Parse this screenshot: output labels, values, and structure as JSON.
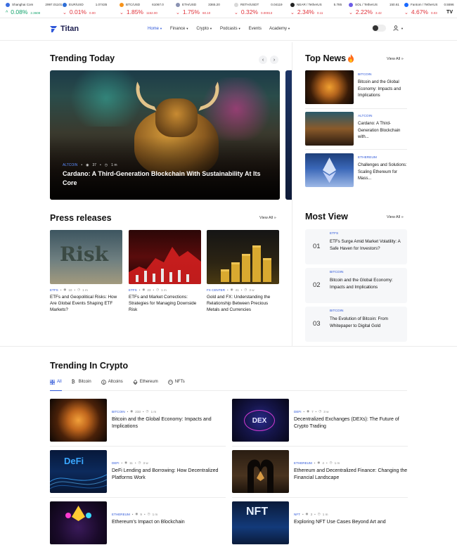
{
  "ticker": [
    {
      "name": "Shanghai Com",
      "price": "2997.01101",
      "change": "0.08%",
      "sub": "2.3608",
      "dir": "up",
      "dot": "#3a6de0"
    },
    {
      "name": "EUR/USD",
      "price": "1.07435",
      "change": "0.01%",
      "sub": "0.00",
      "dir": "down",
      "dot": "#2f6fd6"
    },
    {
      "name": "BTC/USD",
      "price": "61067.0",
      "change": "1.85%",
      "sub": "1152.00",
      "dir": "down",
      "dot": "#f7931a"
    },
    {
      "name": "ETH/USD",
      "price": "3365.20",
      "change": "1.75%",
      "sub": "60.10",
      "dir": "down",
      "dot": "#8a92b2"
    },
    {
      "name": "RETH/USDT",
      "price": "0.04119",
      "change": "0.32%",
      "sub": "0.00013",
      "dir": "down",
      "dot": "#d8d8d8"
    },
    {
      "name": "NEAR / TetherUS",
      "price": "5.785",
      "change": "2.34%",
      "sub": "0.11",
      "dir": "down",
      "dot": "#222222"
    },
    {
      "name": "SOL / TetherUS",
      "price": "150.61",
      "change": "2.22%",
      "sub": "3.42",
      "dir": "down",
      "dot": "#6c5ce7"
    },
    {
      "name": "Fantom / TetherUS",
      "price": "0.5596",
      "change": "4.67%",
      "sub": "0.03",
      "dir": "down",
      "dot": "#1969ff"
    }
  ],
  "tv_logo": "TV",
  "brand": {
    "name": "Titan"
  },
  "menu": [
    {
      "label": "Home",
      "active": true,
      "caret": true
    },
    {
      "label": "Finance",
      "active": false,
      "caret": true
    },
    {
      "label": "Crypto",
      "active": false,
      "caret": true
    },
    {
      "label": "Podcasts",
      "active": false,
      "caret": true
    },
    {
      "label": "Events",
      "active": false,
      "caret": false
    },
    {
      "label": "Academy",
      "active": false,
      "caret": true
    }
  ],
  "trending_today": {
    "title": "Trending Today",
    "prev": "‹",
    "next": "›",
    "hero": {
      "category": "ALTCOIN",
      "views": "37",
      "read_time": "1 m",
      "title": "Cardano: A Third-Generation Blockchain With Sustainability At Its Core"
    }
  },
  "top_news": {
    "title": "Top News",
    "view_all": "View All",
    "items": [
      {
        "category": "BITCOIN",
        "title": "Bitcoin and the Global Economy: Impacts and Implications"
      },
      {
        "category": "ALTCOIN",
        "title": "Cardano: A Third-Generation Blockchain with..."
      },
      {
        "category": "ETHEREUM",
        "title": "Challenges and Solutions: Scaling Ethereum for Mass..."
      }
    ]
  },
  "press_releases": {
    "title": "Press releases",
    "view_all": "View All",
    "items": [
      {
        "category": "ETFS",
        "views": "10",
        "read_time": "1 m",
        "title": "ETFs and Geopolitical Risks: How Are Global Events Shaping ETF Markets?",
        "thumb_word": "Risk"
      },
      {
        "category": "ETFS",
        "views": "23",
        "read_time": "1 m",
        "title": "ETFs and Market Corrections: Strategies for Managing Downside Risk",
        "thumb_word": ""
      },
      {
        "category": "FX CENTER",
        "views": "41",
        "read_time": "3 w",
        "title": "Gold and FX: Understanding the Relationship Between Precious Metals and Currencies",
        "thumb_word": ""
      }
    ]
  },
  "most_view": {
    "title": "Most View",
    "view_all": "View All",
    "items": [
      {
        "num": "01",
        "category": "ETFS",
        "title": "ETFs Surge Amid Market Volatility: A Safe Haven for Investors?"
      },
      {
        "num": "02",
        "category": "BITCOIN",
        "title": "Bitcoin and the Global Economy: Impacts and Implications"
      },
      {
        "num": "03",
        "category": "BITCOIN",
        "title": "The Evolution of Bitcoin: From Whitepaper to Digital Gold"
      }
    ]
  },
  "trending_crypto": {
    "title": "Trending In Crypto",
    "tabs": [
      {
        "label": "All",
        "active": true
      },
      {
        "label": "Bitcoin",
        "active": false
      },
      {
        "label": "Altcoins",
        "active": false
      },
      {
        "label": "Ethereum",
        "active": false
      },
      {
        "label": "NFTs",
        "active": false
      }
    ],
    "items": [
      {
        "category": "BITCOIN",
        "views": "233",
        "read_time": "1 m",
        "title": "Bitcoin and the Global Economy: Impacts and Implications",
        "thumb_word": ""
      },
      {
        "category": "DEFI",
        "views": "7",
        "read_time": "3 w",
        "title": "Decentralized Exchanges (DEXs): The Future of Crypto Trading",
        "thumb_word": "DEX"
      },
      {
        "category": "DEFI",
        "views": "11",
        "read_time": "3 w",
        "title": "DeFi Lending and Borrowing: How Decentralized Platforms Work",
        "thumb_word": "DeFi"
      },
      {
        "category": "ETHEREUM",
        "views": "4",
        "read_time": "1 m",
        "title": "Ethereum and Decentralized Finance: Changing the Financial Landscape",
        "thumb_word": ""
      },
      {
        "category": "ETHEREUM",
        "views": "9",
        "read_time": "1 m",
        "title": "Ethereum's Impact on Blockchain",
        "thumb_word": ""
      },
      {
        "category": "NFT",
        "views": "3",
        "read_time": "1 m",
        "title": "Exploring NFT Use Cases Beyond Art and",
        "thumb_word": "NFT"
      }
    ]
  },
  "colors": {
    "accent": "#2d56d8",
    "up": "#12a36b",
    "down": "#e0333b",
    "brand_dark": "#1b1d4e"
  }
}
